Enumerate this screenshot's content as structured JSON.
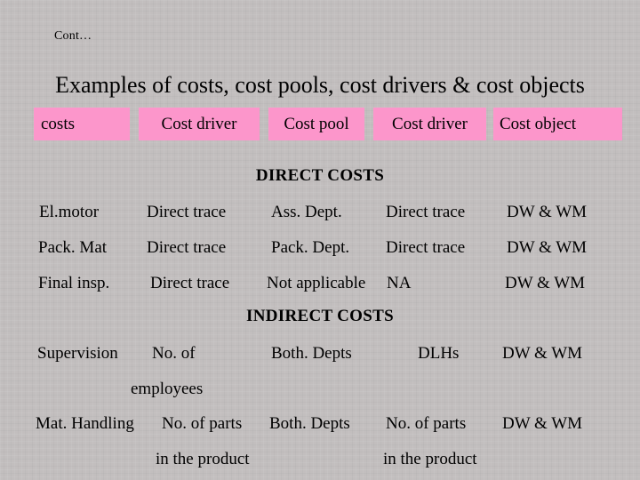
{
  "slide": {
    "kicker": "Cont…",
    "title": "Examples of costs, cost pools, cost drivers & cost objects",
    "background_color": "#c2bebe",
    "accent_color": "#fc96cb",
    "text_color": "#000000"
  },
  "header": {
    "boxes": [
      {
        "label": "costs"
      },
      {
        "label": "Cost driver"
      },
      {
        "label": "Cost pool"
      },
      {
        "label": "Cost driver"
      },
      {
        "label": "Cost object"
      }
    ]
  },
  "sections": [
    {
      "heading": "DIRECT COSTS",
      "rows": [
        {
          "cost": "El.motor",
          "driver1": "Direct trace",
          "pool": "Ass. Dept.",
          "driver2": "Direct trace",
          "object": "DW & WM"
        },
        {
          "cost": "Pack. Mat",
          "driver1": "Direct trace",
          "pool": "Pack. Dept.",
          "driver2": "Direct trace",
          "object": "DW & WM"
        },
        {
          "cost": "Final insp.",
          "driver1": "Direct trace",
          "pool": "Not applicable",
          "driver2": "NA",
          "object": "DW & WM"
        }
      ]
    },
    {
      "heading": "INDIRECT COSTS",
      "rows": [
        {
          "cost": "Supervision",
          "driver1": "No. of",
          "driver1_cont": "employees",
          "pool": "Both. Depts",
          "driver2": "DLHs",
          "object": "DW & WM"
        },
        {
          "cost": "Mat. Handling",
          "driver1": "No. of parts",
          "driver1_cont": "in the product",
          "pool": "Both. Depts",
          "driver2": "No. of parts",
          "driver2_cont": "in the product",
          "object": "DW & WM"
        }
      ]
    }
  ]
}
